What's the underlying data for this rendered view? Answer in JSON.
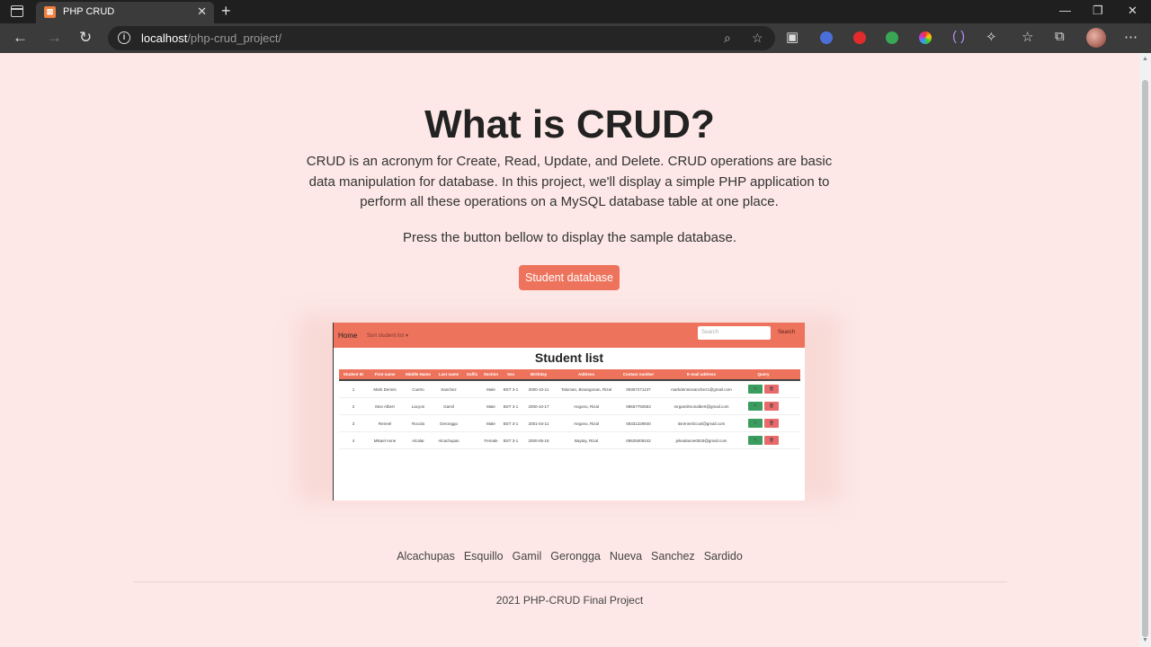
{
  "browser": {
    "tab_title": "PHP CRUD",
    "url_host": "localhost",
    "url_path": "/php-crud_project/"
  },
  "hero": {
    "title": "What is CRUD?",
    "description": "CRUD is an acronym for Create, Read, Update, and Delete. CRUD operations are basic data manipulation for database. In this project, we'll display a simple PHP application to perform all these operations on a MySQL database table at one place.",
    "prompt": "Press the button bellow to display the sample database.",
    "button_label": "Student database"
  },
  "preview": {
    "nav_home": "Home",
    "nav_sort": "Sort student list",
    "search_placeholder": "Search",
    "search_button": "Search",
    "heading": "Student list",
    "columns": [
      "Student ID",
      "First name",
      "Middle Name",
      "Last name",
      "Suffix",
      "Section",
      "Sex",
      "Birthday",
      "Address",
      "Contact number",
      "E-mail address",
      "Query"
    ],
    "rows": [
      [
        "1",
        "Mark Dennis",
        "Cuerto",
        "Sanchez",
        "",
        "Male",
        "BST 3-1",
        "2000-10-11",
        "Taluman, Binangonan, Rizal",
        "09367271137",
        "markdennissanchez1@gmail.com"
      ],
      [
        "2",
        "Mon Albert",
        "Lacyon",
        "Gamil",
        "",
        "Male",
        "BST 3-1",
        "2000-10-17",
        "Angono, Rizal",
        "09667792553",
        "mrgamilmonalbert@gmail.com"
      ],
      [
        "3",
        "Rennel",
        "Rocola",
        "Geronggo",
        "",
        "Male",
        "BST 3-1",
        "2001-04-11",
        "Angono, Rizal",
        "09331329840",
        "itsrennelzcool@gmail.com"
      ],
      [
        "4",
        "Mikael Anne",
        "Alcalar",
        "Alcachupas",
        "",
        "Female",
        "BST 3-1",
        "2000-05-18",
        "Baytay, Rizal",
        "09625009242",
        "jekealanne0818@gmail.com"
      ]
    ]
  },
  "footer": {
    "names": [
      "Alcachupas",
      "Esquillo",
      "Gamil",
      "Gerongga",
      "Nueva",
      "Sanchez",
      "Sardido"
    ],
    "copyright": "2021 PHP-CRUD Final Project"
  }
}
